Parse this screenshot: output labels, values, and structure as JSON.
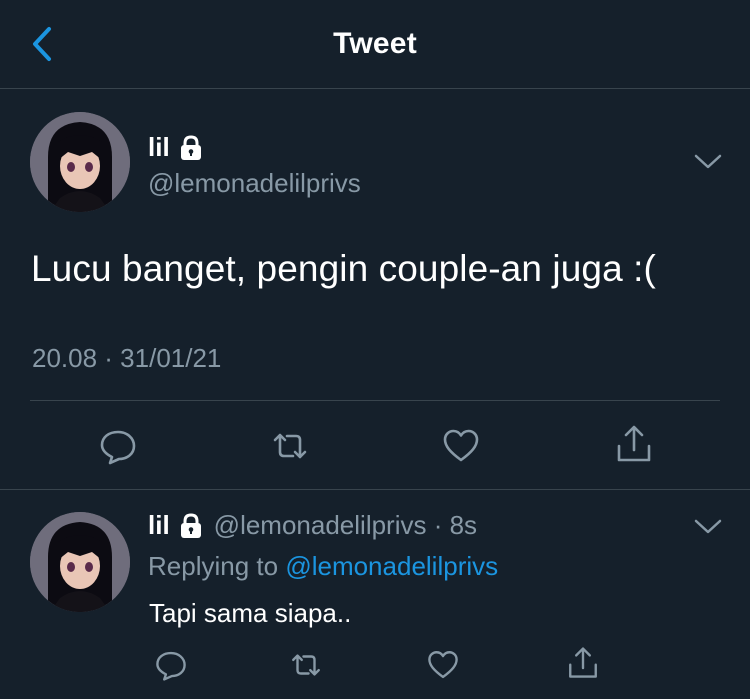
{
  "header": {
    "title": "Tweet",
    "back_icon": "chevron-left-icon"
  },
  "tweet": {
    "display_name": "lil",
    "handle": "@lemonadelilprivs",
    "text": "Lucu banget, pengin couple-an juga :(",
    "timestamp": "20.08 · 31/01/21",
    "actions": [
      "reply-icon",
      "retweet-icon",
      "like-icon",
      "share-icon"
    ]
  },
  "reply": {
    "display_name": "lil",
    "handle_time": "@lemonadelilprivs · 8s",
    "replying_prefix": "Replying to ",
    "replying_handle": "@lemonadelilprivs",
    "text": "Tapi sama siapa.."
  },
  "colors": {
    "background": "#15202b",
    "secondary_text": "#8899a6",
    "accent": "#1b95e0",
    "divider": "#38444d"
  }
}
